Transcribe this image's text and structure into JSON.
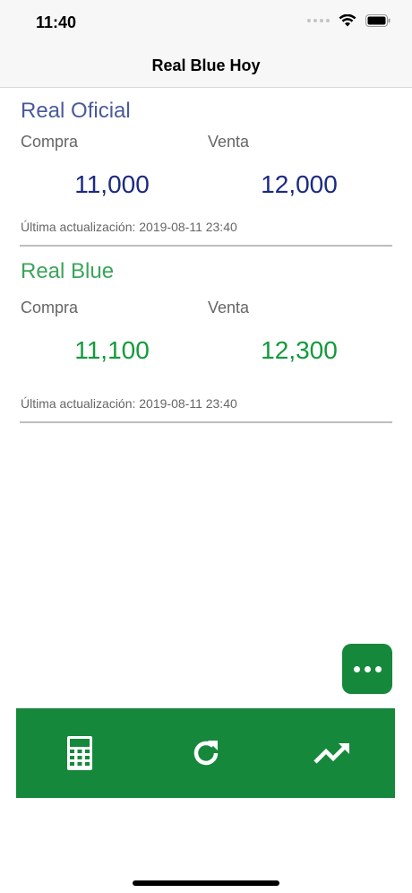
{
  "status_bar": {
    "time": "11:40"
  },
  "nav": {
    "title": "Real Blue Hoy"
  },
  "oficial": {
    "title": "Real Oficial",
    "buy_label": "Compra",
    "sell_label": "Venta",
    "buy_value": "11,000",
    "sell_value": "12,000",
    "updated": "Última actualización: 2019-08-11 23:40"
  },
  "blue": {
    "title": "Real Blue",
    "buy_label": "Compra",
    "sell_label": "Venta",
    "buy_value": "11,100",
    "sell_value": "12,300",
    "updated": "Última actualización: 2019-08-11 23:40"
  },
  "toolbar": {
    "items": [
      {
        "icon": "calculator-icon"
      },
      {
        "icon": "refresh-icon"
      },
      {
        "icon": "trending-up-icon"
      }
    ]
  },
  "fab": {
    "icon": "more-dots-icon"
  },
  "colors": {
    "brand_green": "#16883b",
    "oficial_blue": "#1c2a80",
    "blue_green": "#149a3c"
  }
}
